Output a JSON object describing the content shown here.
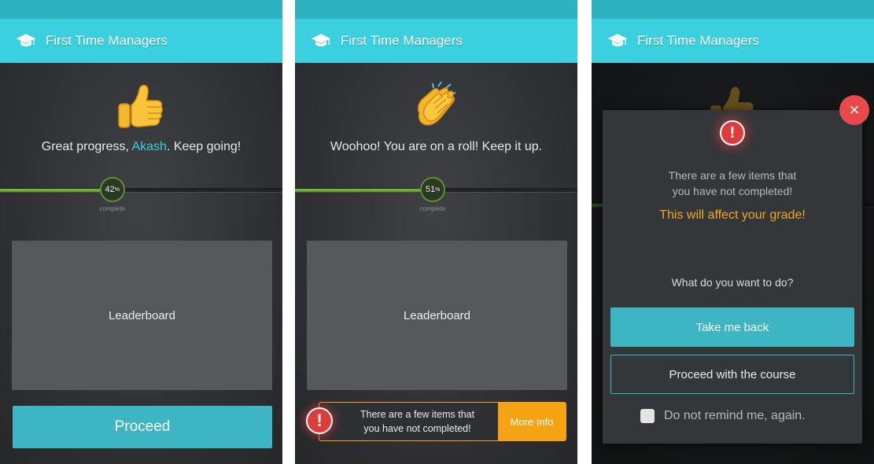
{
  "app": {
    "title": "First Time Managers"
  },
  "screen1": {
    "message_prefix": "Great progress, ",
    "user_name": "Akash",
    "message_suffix": ". Keep going!",
    "progress_value": "42",
    "progress_unit": "%",
    "progress_fraction": 0.42,
    "progress_label": "complete",
    "leaderboard_label": "Leaderboard",
    "proceed_label": "Proceed"
  },
  "screen2": {
    "message": "Woohoo! You are on a roll! Keep it up.",
    "progress_value": "51",
    "progress_unit": "%",
    "progress_fraction": 0.51,
    "progress_label": "complete",
    "leaderboard_label": "Leaderboard",
    "warning_badge": "!",
    "warning_line1": "There are a few items that",
    "warning_line2": "you have not completed!",
    "more_info_label": "More Info"
  },
  "screen3": {
    "close_icon": "×",
    "warning_badge": "!",
    "warning_line1": "There are a few items that",
    "warning_line2": "you have not completed!",
    "grade_warning": "This will affect your grade!",
    "question": "What do you want to do?",
    "take_back_label": "Take me back",
    "proceed_label": "Proceed with the course",
    "remind_label": "Do not remind me, again."
  },
  "colors": {
    "accent": "#3bd0e0",
    "button": "#3db5c3",
    "warning": "#f5a623",
    "alert": "#e03b3b",
    "progress": "#6aa83c"
  },
  "icons": {
    "app": "graduation-cap-icon",
    "screen1": "thumbs-up-icon",
    "screen2": "clapping-hands-icon"
  }
}
